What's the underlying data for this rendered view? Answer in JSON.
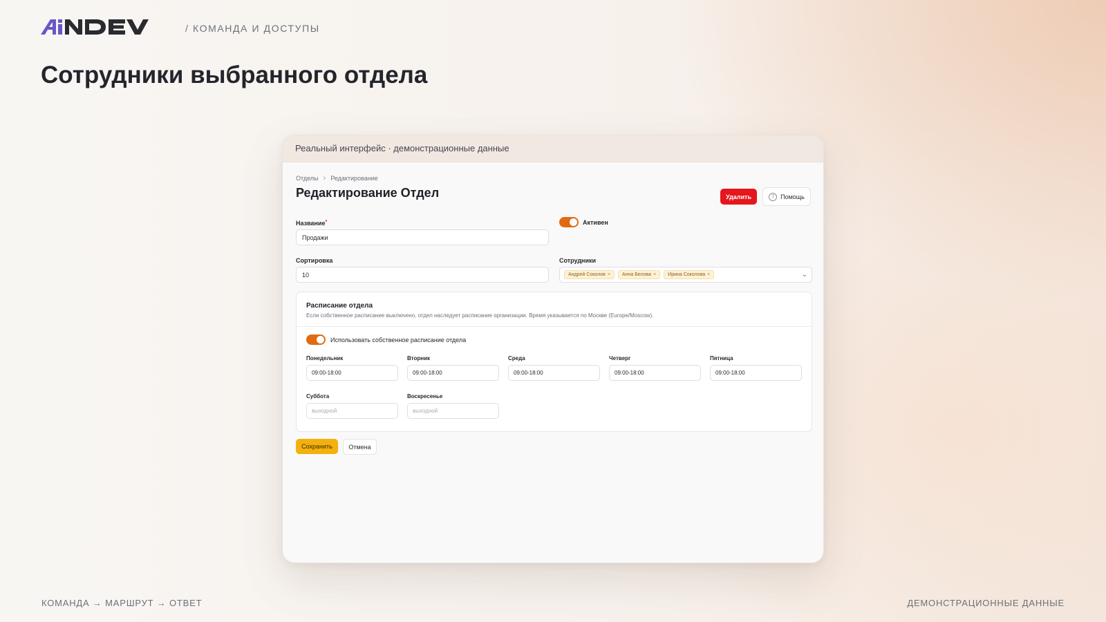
{
  "slide": {
    "logo_text": "AiNDEV",
    "section_label": "/ КОМАНДА И ДОСТУПЫ",
    "title": "Сотрудники выбранного отдела",
    "footer_left": "КОМАНДА → МАРШРУТ → ОТВЕТ",
    "footer_right": "ДЕМОНСТРАЦИОННЫЕ ДАННЫЕ",
    "brand_color": "#6b56c9"
  },
  "frame": {
    "caption": "Реальный интерфейс · демонстрационные данные"
  },
  "breadcrumb": {
    "items": [
      "Отделы",
      "Редактирование"
    ],
    "separator_icon": "chevron-right-icon"
  },
  "page": {
    "title": "Редактирование Отдел"
  },
  "actions": {
    "delete_label": "Удалить",
    "help_label": "Помощь",
    "help_icon": "question-circle-icon",
    "save_label": "Сохранить",
    "cancel_label": "Отмена"
  },
  "form": {
    "name": {
      "label": "Название",
      "required_mark": "*",
      "value": "Продажи"
    },
    "active": {
      "label": "Активен",
      "checked": true
    },
    "sort": {
      "label": "Сортировка",
      "value": "10"
    },
    "employees": {
      "label": "Сотрудники",
      "tags": [
        "Андрей Соколов",
        "Анна Белова",
        "Ирина Соколова"
      ],
      "remove_icon": "×",
      "dropdown_icon": "chevron-down-icon"
    }
  },
  "schedule": {
    "title": "Расписание отдела",
    "description": "Если собственное расписание выключено, отдел наследует расписание организации. Время указывается по Москве (Europe/Moscow).",
    "own_toggle": {
      "label": "Использовать собственное расписание отдела",
      "checked": true
    },
    "days": [
      {
        "label": "Понедельник",
        "value": "09:00-18:00"
      },
      {
        "label": "Вторник",
        "value": "09:00-18:00"
      },
      {
        "label": "Среда",
        "value": "09:00-18:00"
      },
      {
        "label": "Четверг",
        "value": "09:00-18:00"
      },
      {
        "label": "Пятница",
        "value": "09:00-18:00"
      },
      {
        "label": "Суббота",
        "placeholder": "выходной"
      },
      {
        "label": "Воскресенье",
        "placeholder": "выходной"
      }
    ]
  },
  "colors": {
    "accent_toggle": "#e06b12",
    "danger": "#e5161c",
    "primary_button": "#f4b10d",
    "tag_bg": "#fdf1d6"
  }
}
